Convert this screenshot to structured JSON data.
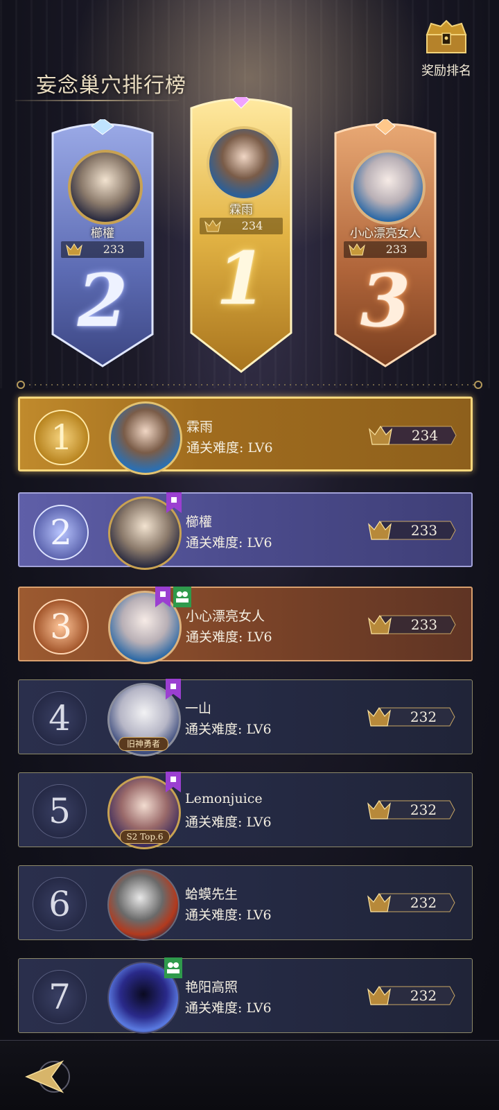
{
  "header": {
    "title": "妄念巢穴排行榜",
    "reward_label": "奖励排名",
    "reward_icon": "treasure-chest-icon"
  },
  "podium": [
    {
      "place": "2",
      "name": "櫛權",
      "score": "233",
      "theme": "#6f7fc4"
    },
    {
      "place": "1",
      "name": "霖雨",
      "score": "234",
      "theme": "#d9a83a"
    },
    {
      "place": "3",
      "name": "小心漂亮女人",
      "score": "233",
      "theme": "#b86e40"
    }
  ],
  "rows": [
    {
      "rank": "1",
      "name": "霖雨",
      "difficulty": "通关难度: LV6",
      "score": "234",
      "theme": "gold"
    },
    {
      "rank": "2",
      "name": "櫛權",
      "difficulty": "通关难度: LV6",
      "score": "233",
      "theme": "silver"
    },
    {
      "rank": "3",
      "name": "小心漂亮女人",
      "difficulty": "通关难度: LV6",
      "score": "233",
      "theme": "bronze"
    },
    {
      "rank": "4",
      "name": "一山",
      "difficulty": "通关难度: LV6",
      "score": "232",
      "theme": "normal",
      "avatar_caption": "旧神勇者"
    },
    {
      "rank": "5",
      "name": "Lemonjuice",
      "difficulty": "通关难度: LV6",
      "score": "232",
      "theme": "normal",
      "avatar_caption": "S2 Top.6"
    },
    {
      "rank": "6",
      "name": "蛤蟆先生",
      "difficulty": "通关难度: LV6",
      "score": "232",
      "theme": "normal"
    },
    {
      "rank": "7",
      "name": "艳阳高照",
      "difficulty": "通关难度: LV6",
      "score": "232",
      "theme": "normal"
    }
  ],
  "footer": {
    "back_icon": "back-arrow-icon"
  }
}
